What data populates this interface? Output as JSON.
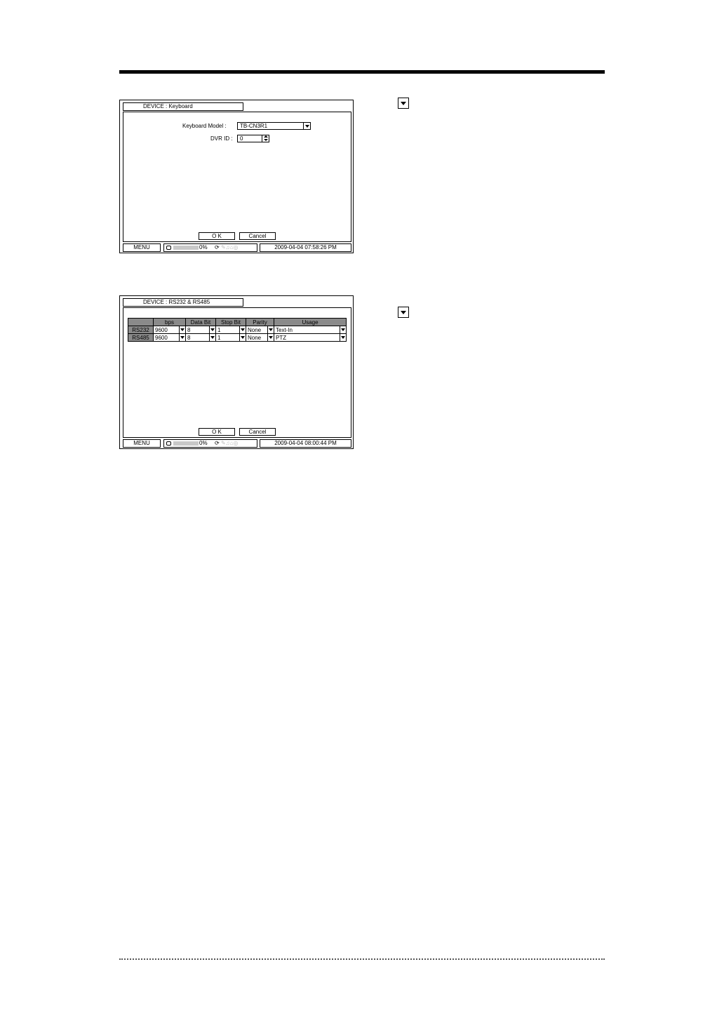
{
  "screen1": {
    "title": "DEVICE : Keyboard",
    "keyboard_model_label": "Keyboard Model :",
    "keyboard_model_value": "TB-CN3R1",
    "dvr_id_label": "DVR ID :",
    "dvr_id_value": "0",
    "ok_label": "O K",
    "cancel_label": "Cancel",
    "status": {
      "menu": "MENU",
      "hdd_pct": "0%",
      "datetime": "2009-04-04  07:58:26 PM"
    }
  },
  "screen2": {
    "title": "DEVICE : RS232 & RS485",
    "columns": [
      "",
      "bps",
      "Data Bit",
      "Stop Bit",
      "Parity",
      "Usage"
    ],
    "rows": [
      {
        "port": "RS232",
        "bps": "9600",
        "data_bit": "8",
        "stop_bit": "1",
        "parity": "None",
        "usage": "Text-In"
      },
      {
        "port": "RS485",
        "bps": "9600",
        "data_bit": "8",
        "stop_bit": "1",
        "parity": "None",
        "usage": "PTZ"
      }
    ],
    "ok_label": "O K",
    "cancel_label": "Cancel",
    "status": {
      "menu": "MENU",
      "hdd_pct": "0%",
      "datetime": "2009-04-04  08:00:44 PM"
    }
  },
  "icons": {
    "side_dropdown_1": "dropdown-arrow-icon",
    "side_dropdown_2": "dropdown-arrow-icon"
  }
}
